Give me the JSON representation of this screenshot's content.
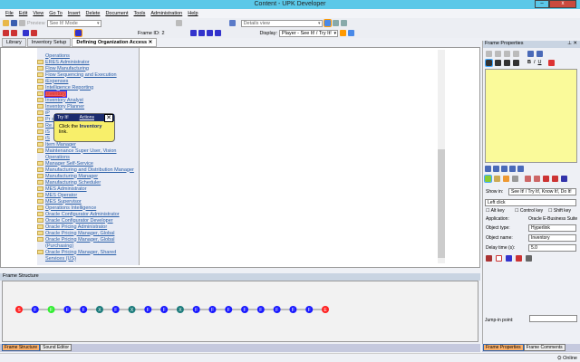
{
  "window": {
    "title": "Content - UPK Developer",
    "minimize": "–",
    "restore": "❐",
    "close": "x"
  },
  "menu": [
    "File",
    "Edit",
    "View",
    "Go To",
    "Insert",
    "Delete",
    "Document",
    "Tools",
    "Administration",
    "Help"
  ],
  "toolbar": {
    "preview_label": "Preview",
    "mode_select": "See It! Mode",
    "view_select": "Details view",
    "frame_id_label": "Frame ID:",
    "frame_id": "2",
    "display_label": "Display:",
    "display_select": "Player - See It! / Try It!"
  },
  "tabs": [
    {
      "label": "Library"
    },
    {
      "label": "Inventory Setup"
    },
    {
      "label": "Defining Organization Access",
      "close": "✕"
    }
  ],
  "list": [
    {
      "t": "Operations",
      "cont": true
    },
    {
      "t": "ERES Administrator"
    },
    {
      "t": "Flow Manufacturing"
    },
    {
      "t": "Flow Sequencing and Execution"
    },
    {
      "t": "iExpenses"
    },
    {
      "t": "Intelligence Reporting"
    },
    {
      "t": "Inventory",
      "hl": true
    },
    {
      "t": "Inventory Analyst"
    },
    {
      "t": "Inventory Planner"
    },
    {
      "t": "iP"
    },
    {
      "t": "Pr                   stration"
    },
    {
      "t": "Re                   ate"
    },
    {
      "t": "iS"
    },
    {
      "t": "iS"
    },
    {
      "t": "Item Manager"
    },
    {
      "t": "Maintenance Super User, Vision"
    },
    {
      "t": "Operations",
      "cont": true
    },
    {
      "t": "Manager Self-Service"
    },
    {
      "t": "Manufacturing and Distribution Manager"
    },
    {
      "t": "Manufacturing Manager"
    },
    {
      "t": "Manufacturing Scheduler"
    },
    {
      "t": "MES Administrator"
    },
    {
      "t": "MES Operator"
    },
    {
      "t": "MES Supervisor"
    },
    {
      "t": "Operations Intelligence"
    },
    {
      "t": "Oracle Configurator Administrator"
    },
    {
      "t": "Oracle Configurator Developer"
    },
    {
      "t": "Oracle Pricing Administrator"
    },
    {
      "t": "Oracle Pricing Manager, Global"
    },
    {
      "t": "Oracle Pricing Manager, Global"
    },
    {
      "t": "(Purchasing)",
      "cont": true
    },
    {
      "t": "Oracle Pricing Manager, Shared"
    },
    {
      "t": "Services (US)",
      "cont": true
    }
  ],
  "tooltip": {
    "title": "Try It!",
    "actions": "Actions",
    "close": "✕",
    "text_pre": "Click the ",
    "text_bold": "Inventory",
    "text_post": " link."
  },
  "frame_structure": {
    "title": "Frame Structure",
    "nodes": [
      "S",
      "F",
      "F",
      "F",
      "F",
      "X",
      "F",
      "X",
      "F",
      "F",
      "X",
      "F",
      "F",
      "F",
      "F",
      "F",
      "F",
      "F",
      "F",
      "E"
    ],
    "current_index": 2,
    "colors": {
      "S": "#ff2020",
      "E": "#ff2020",
      "F": "#1a1aff",
      "X": "#1a7a7a",
      "current": "#33ee33"
    }
  },
  "bottom_tabs": [
    "Frame Structure",
    "Sound Editor"
  ],
  "frame_properties": {
    "title": "Frame Properties",
    "pin": "⊥",
    "close": "✕",
    "show_in_label": "Show in:",
    "show_in": "See It! / Try It!, Know It!, Do It!",
    "action": "Left click",
    "alt_key": "Alt key",
    "control_key": "Control key",
    "shift_key": "Shift key",
    "application_label": "Application:",
    "application": "Oracle E-Business Suite",
    "object_type_label": "Object type:",
    "object_type": "Hyperlink",
    "object_name_label": "Object name:",
    "object_name": "Inventory",
    "delay_label": "Delay time (s):",
    "delay": "5.0",
    "jump_in_label": "Jump-in point:",
    "jump_in": ""
  },
  "right_tabs": [
    "Frame Properties",
    "Frame Comments"
  ],
  "status": {
    "online": "Online"
  }
}
